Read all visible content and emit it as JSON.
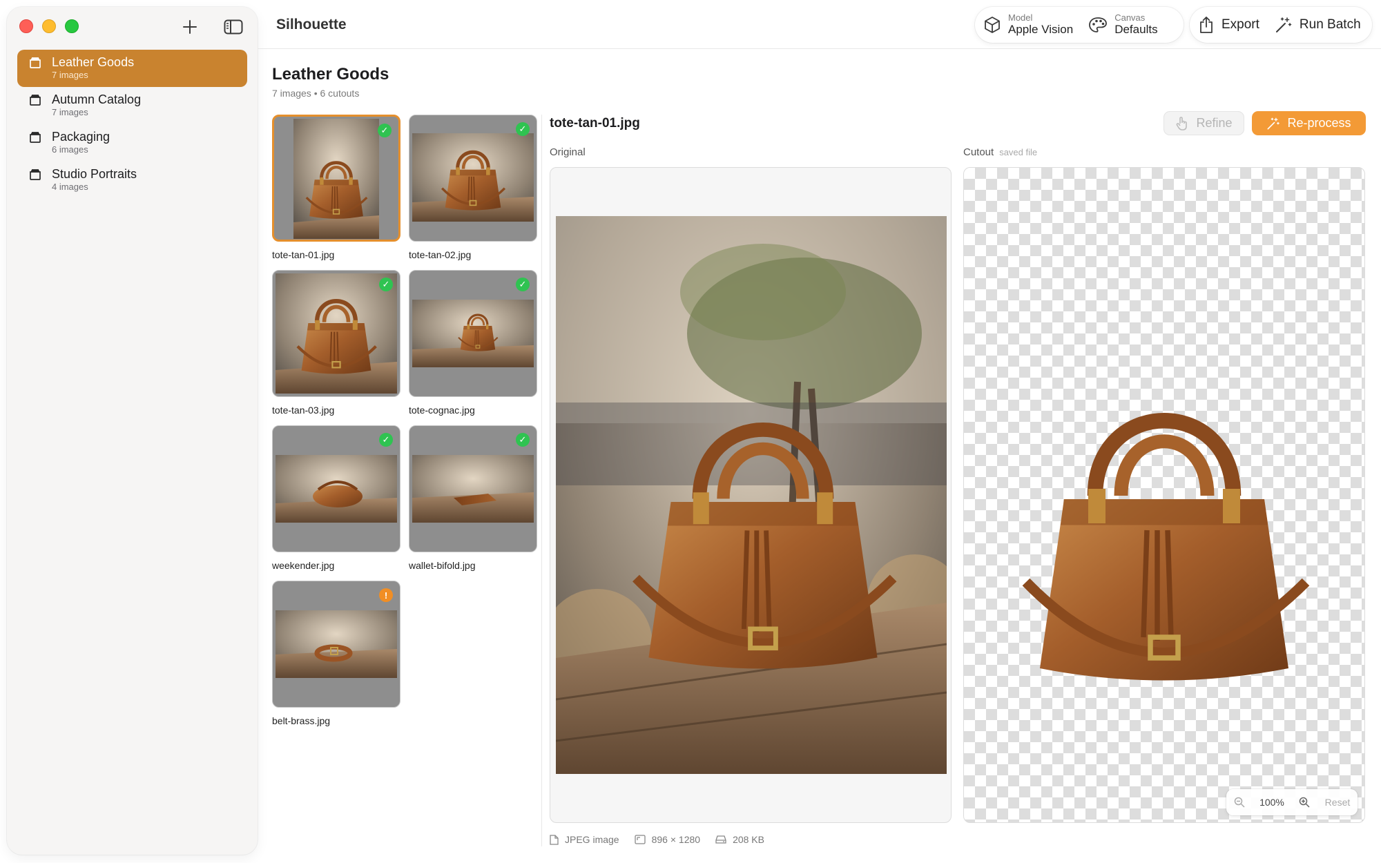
{
  "app": {
    "title": "Silhouette"
  },
  "sidebar": {
    "items": [
      {
        "name": "Leather Goods",
        "count": "7 images"
      },
      {
        "name": "Autumn Catalog",
        "count": "7 images"
      },
      {
        "name": "Packaging",
        "count": "6 images"
      },
      {
        "name": "Studio Portraits",
        "count": "4 images"
      }
    ]
  },
  "toolbar": {
    "model_label": "Model",
    "model_value": "Apple Vision",
    "canvas_label": "Canvas",
    "canvas_value": "Defaults",
    "export_label": "Export",
    "run_batch_label": "Run Batch"
  },
  "collection": {
    "title": "Leather Goods",
    "images": "7 images",
    "cutouts": "6 cutouts"
  },
  "files": [
    {
      "name": "tote-tan-01.jpg",
      "status": "✓"
    },
    {
      "name": "tote-tan-02.jpg",
      "status": "✓"
    },
    {
      "name": "tote-tan-03.jpg",
      "status": "✓"
    },
    {
      "name": "tote-cognac.jpg",
      "status": "✓"
    },
    {
      "name": "weekender.jpg",
      "status": "✓"
    },
    {
      "name": "wallet-bifold.jpg",
      "status": "✓"
    },
    {
      "name": "belt-brass.jpg",
      "status": "!"
    }
  ],
  "detail": {
    "file_name": "tote-tan-01.jpg",
    "refine_label": "Refine",
    "reprocess_label": "Re-process",
    "original_label": "Original",
    "cutout_label": "Cutout",
    "cutout_note": "saved file",
    "zoom_value": "100%",
    "reset_label": "Reset"
  },
  "footer": {
    "type": "JPEG image",
    "dimensions": "896 × 1280",
    "size": "208 KB"
  },
  "colors": {
    "accent": "#c9832f",
    "primary_button": "#f39a36",
    "ok_badge": "#2fc351",
    "warn_badge": "#f18e24"
  }
}
